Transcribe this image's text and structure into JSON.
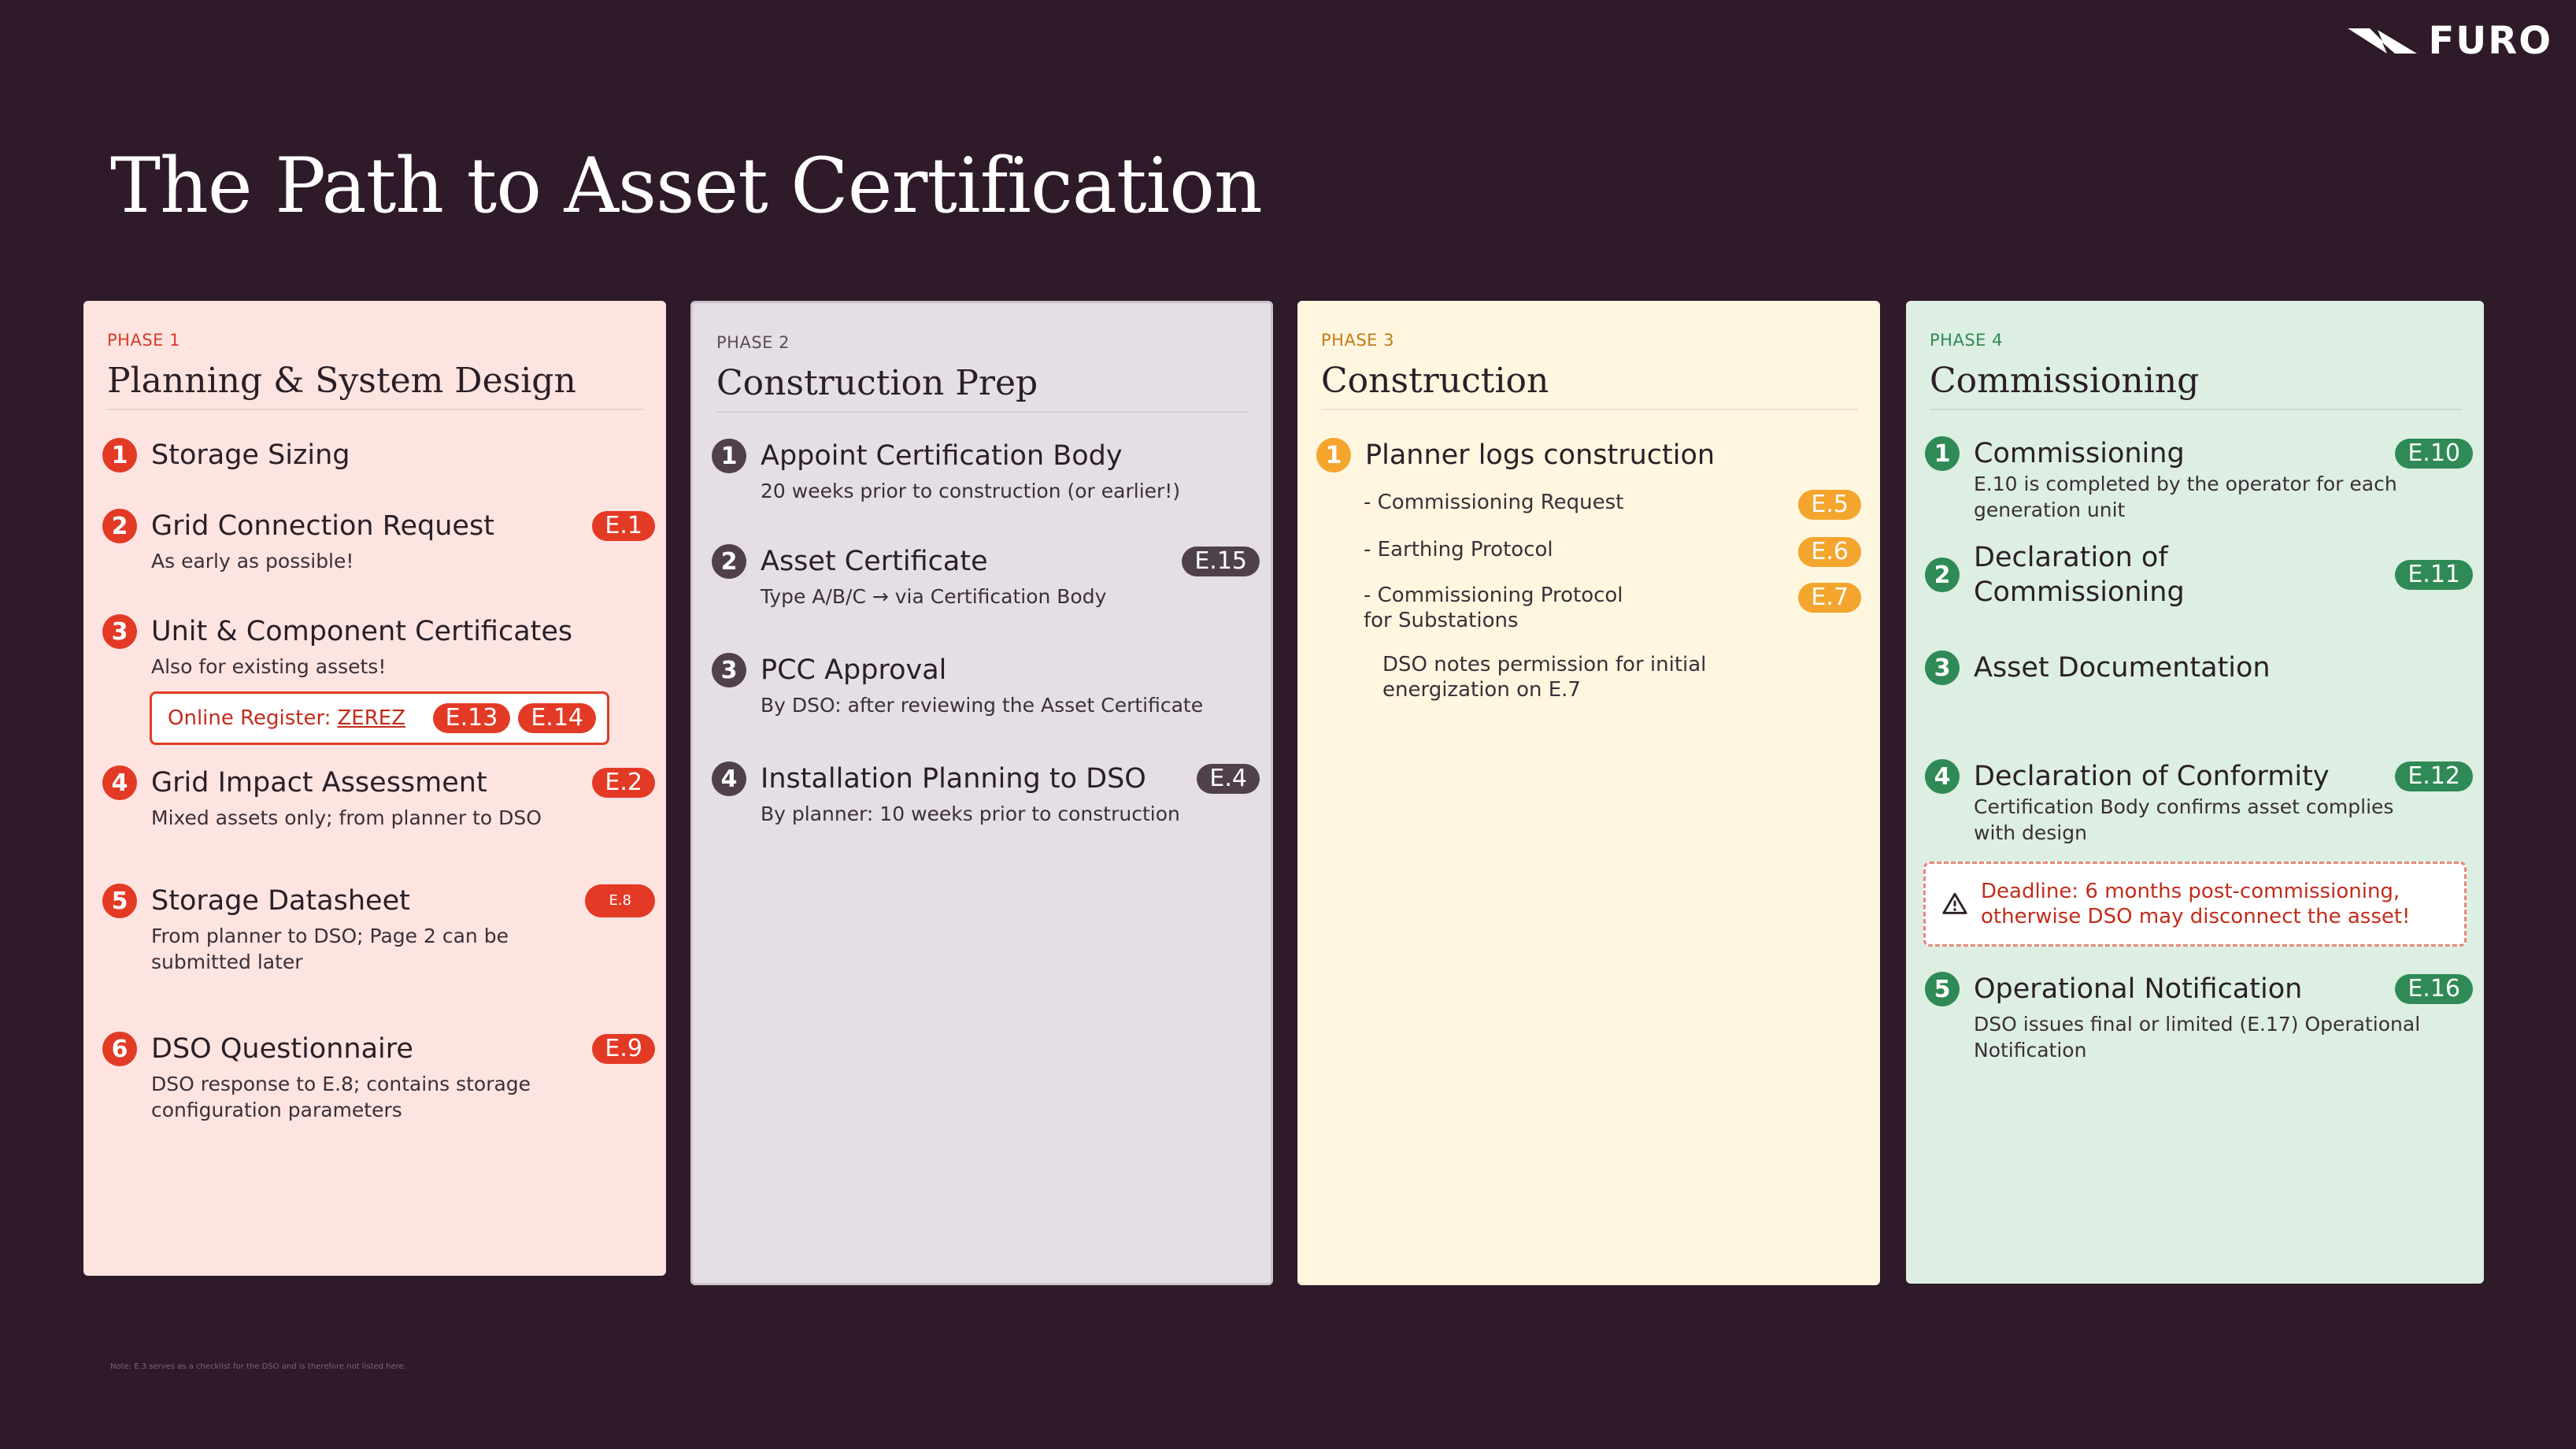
{
  "brand": {
    "name": "FURO"
  },
  "title": "The Path to Asset Certification",
  "footnote": "Note: E.3 serves as a checklist for the DSO and is therefore not listed here.",
  "phases": [
    {
      "label": "PHASE 1",
      "title": "Planning & System Design",
      "items": [
        {
          "num": "1",
          "title": "Storage Sizing",
          "desc": "",
          "badge": ""
        },
        {
          "num": "2",
          "title": "Grid Connection Request",
          "desc": "As early as possible!",
          "badge": "E.1"
        },
        {
          "num": "3",
          "title": "Unit & Component Certificates",
          "desc": "Also for existing assets!",
          "badge": ""
        },
        {
          "num": "4",
          "title": "Grid Impact Assessment",
          "desc": "Mixed assets only; from planner to DSO",
          "badge": "E.2"
        },
        {
          "num": "5",
          "title": "Storage Datasheet",
          "desc": "From planner to DSO; Page 2 can be submitted later",
          "badge": "E.8"
        },
        {
          "num": "6",
          "title": "DSO Questionnaire",
          "desc": "DSO response to E.8; contains storage configuration parameters",
          "badge": "E.9"
        }
      ],
      "register": {
        "label": "Online Register:",
        "link": "ZEREZ",
        "badges": [
          "E.13",
          "E.14"
        ]
      }
    },
    {
      "label": "PHASE 2",
      "title": "Construction Prep",
      "items": [
        {
          "num": "1",
          "title": "Appoint Certification Body",
          "desc": "20 weeks prior to construction (or earlier!)",
          "badge": ""
        },
        {
          "num": "2",
          "title": "Asset Certificate",
          "desc": "Type A/B/C → via Certification Body",
          "badge": "E.15"
        },
        {
          "num": "3",
          "title": "PCC Approval",
          "desc": "By DSO: after reviewing the Asset Certificate",
          "badge": ""
        },
        {
          "num": "4",
          "title": "Installation Planning to DSO",
          "desc": "By planner: 10 weeks prior to construction",
          "badge": "E.4"
        }
      ]
    },
    {
      "label": "PHASE 3",
      "title": "Construction",
      "items": [
        {
          "num": "1",
          "title": "Planner logs construction",
          "desc": "",
          "badge": ""
        }
      ],
      "sub_items": [
        {
          "text": "- Commissioning Request",
          "badge": "E.5"
        },
        {
          "text": "- Earthing Protocol",
          "badge": "E.6"
        },
        {
          "text": "- Commissioning Protocol\n  for Substations",
          "badge": "E.7"
        }
      ],
      "note": "DSO notes permission for initial energization on E.7"
    },
    {
      "label": "PHASE 4",
      "title": "Commissioning",
      "items": [
        {
          "num": "1",
          "title": "Commissioning",
          "desc": "E.10 is completed by the operator for each generation unit",
          "badge": "E.10"
        },
        {
          "num": "2",
          "title": "Declaration of Commissioning",
          "desc": "",
          "badge": "E.11"
        },
        {
          "num": "3",
          "title": "Asset Documentation",
          "desc": "",
          "badge": ""
        },
        {
          "num": "4",
          "title": "Declaration of Conformity",
          "desc": "Certification Body confirms asset complies with design",
          "badge": "E.12"
        },
        {
          "num": "5",
          "title": "Operational Notification",
          "desc": "DSO issues final or limited (E.17) Operational Notification",
          "badge": "E.16"
        }
      ],
      "deadline": "Deadline: 6 months post-commissioning, otherwise DSO may disconnect the asset!"
    }
  ]
}
